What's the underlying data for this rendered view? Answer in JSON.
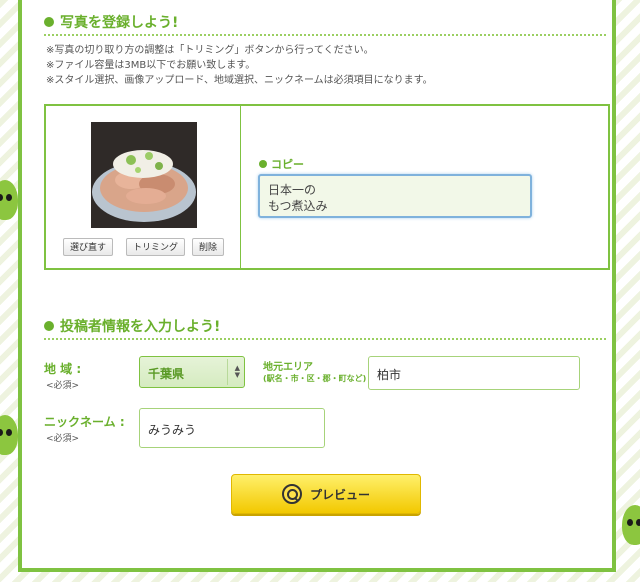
{
  "photo_section": {
    "title": "写真を登録しよう!",
    "notes": [
      "※写真の切り取り方の調整は「トリミング」ボタンから行ってください。",
      "※ファイル容量は3MB以下でお願い致します。",
      "※スタイル選択、画像アップロード、地域選択、ニックネームは必須項目になります。"
    ],
    "buttons": {
      "reselect": "選び直す",
      "trim": "トリミング",
      "delete": "削除"
    },
    "copy_label": "コピー",
    "copy_value": "日本一の\nもつ煮込み"
  },
  "poster_section": {
    "title": "投稿者情報を入力しよう!",
    "region_label": "地 域 :",
    "region_required": "<必須>",
    "prefecture_value": "千葉県",
    "area_label": "地元エリア",
    "area_sub": "(駅名・市・区・郡・町など)",
    "area_value": "柏市",
    "nickname_label": "ニックネーム :",
    "nickname_required": "<必須>",
    "nickname_value": "みうみう"
  },
  "preview_button": {
    "label": "プレビュー"
  },
  "colors": {
    "accent_green": "#6ab02d",
    "button_yellow": "#f2c800"
  }
}
